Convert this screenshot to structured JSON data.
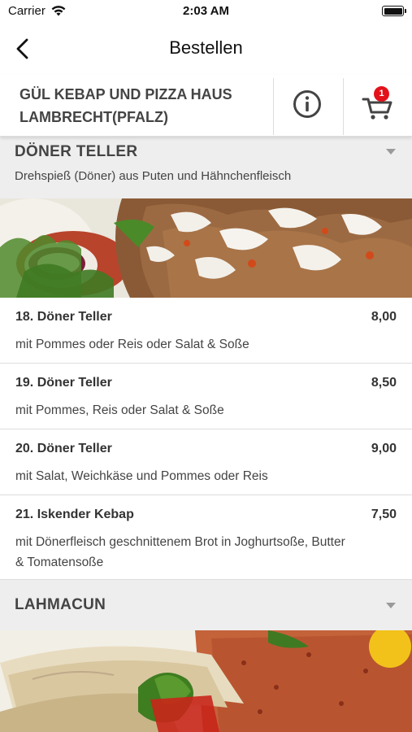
{
  "status_bar": {
    "carrier": "Carrier",
    "time": "2:03 AM"
  },
  "nav": {
    "title": "Bestellen"
  },
  "restaurant": {
    "name_line1": "GÜL KEBAP UND PIZZA HAUS",
    "name_line2": "LAMBRECHT(PFALZ)",
    "cart_count": "1"
  },
  "categories": [
    {
      "title": "DÖNER TELLER",
      "description": "Drehspieß (Döner) aus Puten und Hähnchenfleisch",
      "items": [
        {
          "name": "18. Döner Teller",
          "price": "8,00",
          "description": "mit Pommes oder Reis oder Salat & Soße"
        },
        {
          "name": "19. Döner Teller",
          "price": "8,50",
          "description": "mit Pommes, Reis oder Salat & Soße"
        },
        {
          "name": "20. Döner Teller",
          "price": "9,00",
          "description": "mit Salat, Weichkäse und Pommes oder Reis"
        },
        {
          "name": "21. Iskender Kebap",
          "price": "7,50",
          "description": "mit Dönerfleisch geschnittenem Brot in Joghurtsoße, Butter & Tomatensoße"
        }
      ]
    },
    {
      "title": "LAHMACUN",
      "description": "",
      "items": []
    }
  ],
  "icons": {
    "back": "chevron-left-icon",
    "info": "info-icon",
    "cart": "cart-icon",
    "wifi": "wifi-icon",
    "battery": "battery-icon",
    "expand": "chevron-down-icon"
  },
  "colors": {
    "badge": "#e3121a",
    "category_bg": "#eeeeee",
    "text": "#333333"
  }
}
